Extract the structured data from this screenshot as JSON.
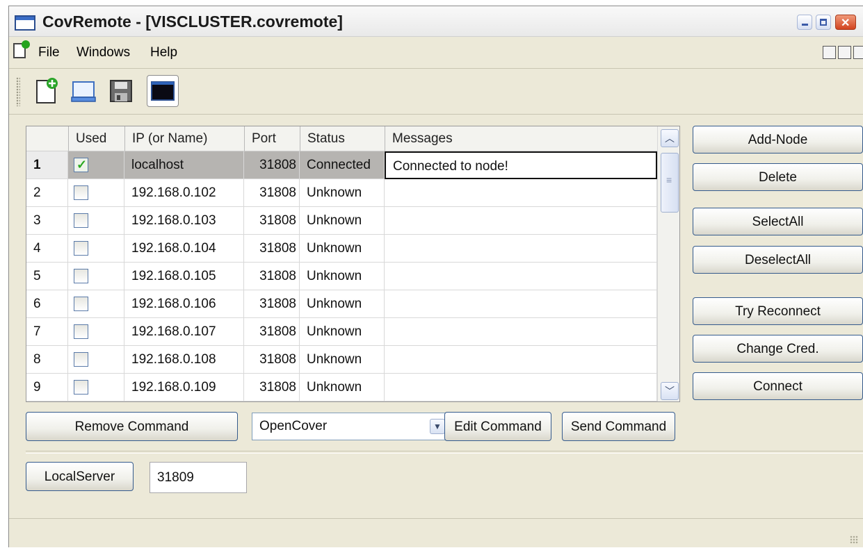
{
  "window": {
    "title": "CovRemote - [VISCLUSTER.covremote]"
  },
  "menu": {
    "items": [
      "File",
      "Windows",
      "Help"
    ]
  },
  "toolbar": {
    "icons": [
      "new-document-icon",
      "open-icon",
      "save-icon",
      "console-icon"
    ]
  },
  "grid": {
    "columns": [
      "Used",
      "IP (or Name)",
      "Port",
      "Status",
      "Messages"
    ],
    "rows": [
      {
        "num": "1",
        "used": true,
        "ip": "localhost",
        "port": "31808",
        "status": "Connected",
        "message": "Connected to node!"
      },
      {
        "num": "2",
        "used": false,
        "ip": "192.168.0.102",
        "port": "31808",
        "status": "Unknown",
        "message": ""
      },
      {
        "num": "3",
        "used": false,
        "ip": "192.168.0.103",
        "port": "31808",
        "status": "Unknown",
        "message": ""
      },
      {
        "num": "4",
        "used": false,
        "ip": "192.168.0.104",
        "port": "31808",
        "status": "Unknown",
        "message": ""
      },
      {
        "num": "5",
        "used": false,
        "ip": "192.168.0.105",
        "port": "31808",
        "status": "Unknown",
        "message": ""
      },
      {
        "num": "6",
        "used": false,
        "ip": "192.168.0.106",
        "port": "31808",
        "status": "Unknown",
        "message": ""
      },
      {
        "num": "7",
        "used": false,
        "ip": "192.168.0.107",
        "port": "31808",
        "status": "Unknown",
        "message": ""
      },
      {
        "num": "8",
        "used": false,
        "ip": "192.168.0.108",
        "port": "31808",
        "status": "Unknown",
        "message": ""
      },
      {
        "num": "9",
        "used": false,
        "ip": "192.168.0.109",
        "port": "31808",
        "status": "Unknown",
        "message": ""
      }
    ]
  },
  "side_buttons": {
    "add_node": "Add-Node",
    "delete": "Delete",
    "select_all": "SelectAll",
    "deselect_all": "DeselectAll",
    "try_reconnect": "Try Reconnect",
    "change_cred": "Change Cred.",
    "connect": "Connect"
  },
  "command": {
    "remove_label": "Remove Command",
    "selected": "OpenCover",
    "edit_label": "Edit Command",
    "send_label": "Send Command"
  },
  "local_server": {
    "button_label": "LocalServer",
    "port": "31809"
  }
}
